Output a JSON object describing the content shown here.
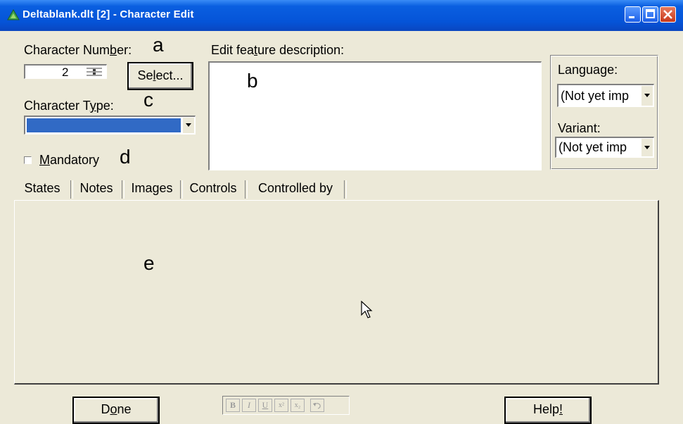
{
  "window": {
    "title": "Deltablank.dlt [2] - Character Edit"
  },
  "character_number": {
    "label_pre": "Character Num",
    "label_acc": "b",
    "label_post": "er:",
    "value": "2",
    "select_pre": "Se",
    "select_acc": "l",
    "select_post": "ect..."
  },
  "description": {
    "label_pre": "Edit fea",
    "label_acc": "t",
    "label_post": "ure description:"
  },
  "character_type": {
    "label_pre": "Character T",
    "label_acc": "y",
    "label_post": "pe:",
    "value": "",
    "highlight_color": "#316ac5"
  },
  "mandatory": {
    "acc": "M",
    "label_post": "andatory",
    "checked": false
  },
  "language": {
    "label": "Language:",
    "value": "(Not yet imp"
  },
  "variant": {
    "label": "Variant:",
    "value": "(Not yet imp"
  },
  "annotations": {
    "a": "a",
    "b": "b",
    "c": "c",
    "d": "d",
    "e": "e"
  },
  "tabs": [
    {
      "label": "States",
      "active": true
    },
    {
      "label": "Notes",
      "active": false
    },
    {
      "label": "Images",
      "active": false
    },
    {
      "label": "Controls",
      "active": false
    },
    {
      "label": "Controlled by",
      "active": false
    }
  ],
  "format_toolbar": {
    "bold": "B",
    "italic": "I",
    "underline": "U",
    "superscript": "x²",
    "subscript": "x₂",
    "undo_icon": "undo-icon"
  },
  "footer": {
    "done_pre": "D",
    "done_acc": "o",
    "done_post": "ne",
    "help_pre": "Help",
    "help_acc": "!"
  },
  "colors": {
    "titlebar": "#0554d8",
    "face": "#ece9d8"
  }
}
